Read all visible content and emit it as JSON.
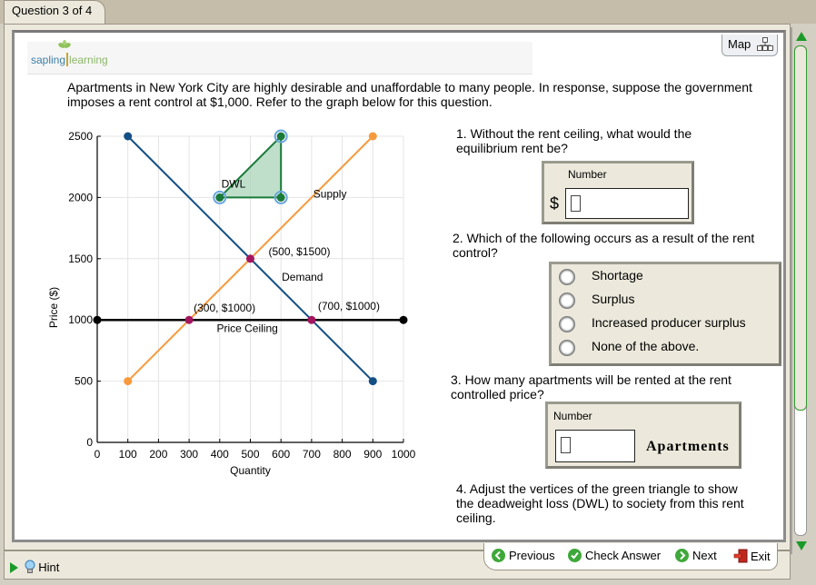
{
  "header": {
    "question_tab": "Question 3 of 4",
    "logo_left": "sapling",
    "logo_right": "learning",
    "map_label": "Map"
  },
  "intro_text": "Apartments in New York City are highly desirable and unaffordable to many people. In response, suppose the government imposes a rent control at $1,000. Refer to the graph below for this question.",
  "chart_data": {
    "type": "line",
    "title": "",
    "xlabel": "Quantity",
    "ylabel": "Price ($)",
    "xlim": [
      0,
      1000
    ],
    "ylim": [
      0,
      2500
    ],
    "x_ticks": [
      "0",
      "100",
      "200",
      "300",
      "400",
      "500",
      "600",
      "700",
      "800",
      "900",
      "1000"
    ],
    "y_ticks": [
      "0",
      "500",
      "1000",
      "1500",
      "2000",
      "2500"
    ],
    "grid": true,
    "series": [
      {
        "name": "Demand",
        "color": "#134f85",
        "points": [
          [
            100,
            2500
          ],
          [
            900,
            500
          ]
        ]
      },
      {
        "name": "Supply",
        "color": "#f79a3c",
        "points": [
          [
            100,
            500
          ],
          [
            900,
            2500
          ]
        ]
      },
      {
        "name": "Price Ceiling",
        "color": "#000000",
        "points": [
          [
            0,
            1000
          ],
          [
            1000,
            1000
          ]
        ]
      }
    ],
    "dwl_triangle": {
      "label": "DWL",
      "color": "#1a7a3a",
      "fill": "#a9d4b9",
      "vertices": [
        [
          400,
          2000
        ],
        [
          600,
          2500
        ],
        [
          600,
          2000
        ]
      ]
    },
    "marked_points": [
      {
        "x": 500,
        "y": 1500,
        "label": "(500, $1500)"
      },
      {
        "x": 300,
        "y": 1000,
        "label": "(300, $1000)"
      },
      {
        "x": 700,
        "y": 1000,
        "label": "(700, $1000)"
      }
    ],
    "curve_labels": [
      {
        "text": "Supply",
        "x": 760,
        "y": 2000
      },
      {
        "text": "Demand",
        "x": 670,
        "y": 1320
      },
      {
        "text": "Price Ceiling",
        "x": 490,
        "y": 900
      },
      {
        "text": "DWL",
        "x": 445,
        "y": 2080
      }
    ]
  },
  "questions": {
    "q1": {
      "text": "1. Without the rent ceiling, what would the equilibrium rent be?",
      "box_label": "Number",
      "prefix": "$",
      "value": ""
    },
    "q2": {
      "text": "2. Which of the following occurs as a result of the rent control?",
      "options": [
        "Shortage",
        "Surplus",
        "Increased producer surplus",
        "None of the above."
      ],
      "selected": null
    },
    "q3": {
      "text": "3. How many apartments will be rented at the rent controlled price?",
      "box_label": "Number",
      "unit": "Apartments",
      "value": ""
    },
    "q4": {
      "text": "4. Adjust the vertices of the green triangle to show the deadweight loss (DWL) to society from this rent ceiling."
    }
  },
  "footer": {
    "hint": "Hint",
    "previous": "Previous",
    "check_answer": "Check Answer",
    "next": "Next",
    "exit": "Exit"
  },
  "scrollbar": {
    "position_fraction": 0.0,
    "visible_fraction": 0.75
  }
}
